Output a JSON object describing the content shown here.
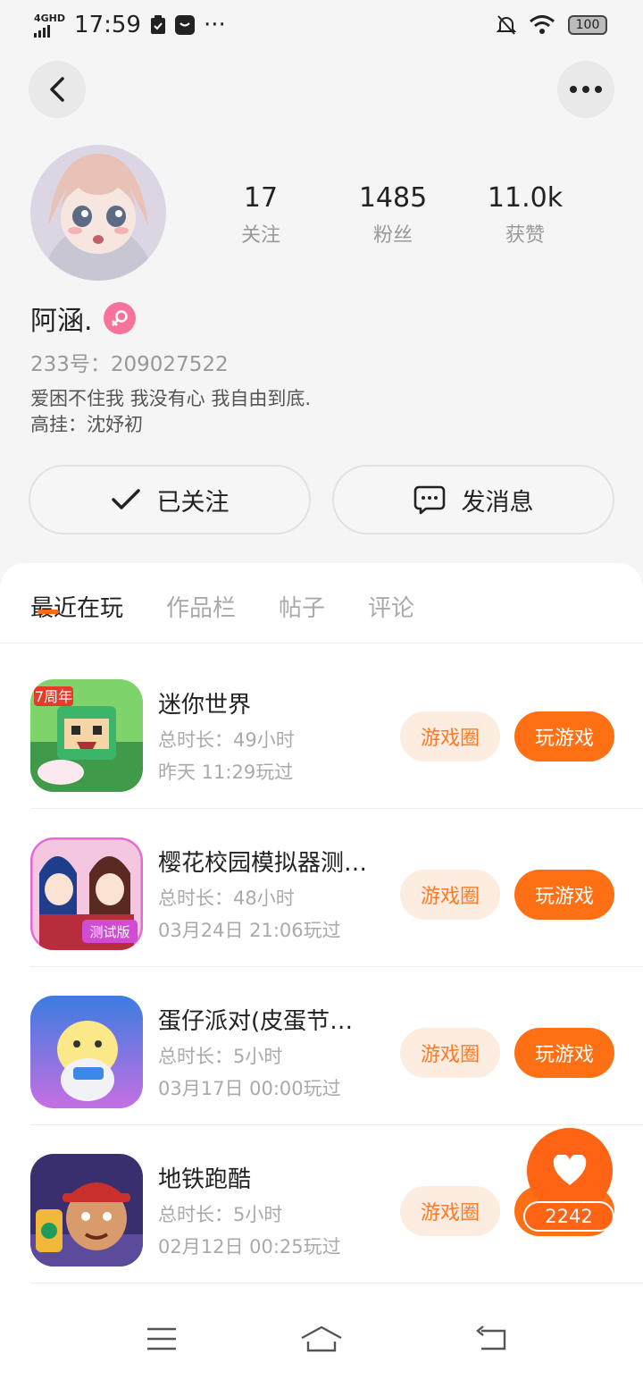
{
  "status_bar": {
    "network": "4GHD",
    "time": "17:59",
    "more": "···",
    "battery": "100"
  },
  "header": {
    "back_icon": "back-arrow-icon",
    "more_icon": "more-dots-icon",
    "more_label": "•••"
  },
  "profile": {
    "name": "阿涵.",
    "gender": "female",
    "uid": "233号：209027522",
    "bio_lines": [
      "爱困不住我 我没有心 我自由到底.",
      "高挂：沈妤初"
    ],
    "stats": [
      {
        "value": "17",
        "label": "关注"
      },
      {
        "value": "1485",
        "label": "粉丝"
      },
      {
        "value": "11.0k",
        "label": "获赞"
      }
    ]
  },
  "actions": {
    "follow_label": "已关注",
    "message_label": "发消息"
  },
  "tabs": [
    "最近在玩",
    "作品栏",
    "帖子",
    "评论"
  ],
  "games": [
    {
      "name": "迷你世界",
      "duration": "总时长：49小时",
      "last_played": "昨天 11:29玩过",
      "circle_label": "游戏圈",
      "play_label": "玩游戏"
    },
    {
      "name": "樱花校园模拟器测…",
      "duration": "总时长：48小时",
      "last_played": "03月24日 21:06玩过",
      "circle_label": "游戏圈",
      "play_label": "玩游戏"
    },
    {
      "name": "蛋仔派对(皮蛋节…",
      "duration": "总时长：5小时",
      "last_played": "03月17日 00:00玩过",
      "circle_label": "游戏圈",
      "play_label": "玩游戏"
    },
    {
      "name": "地铁跑酷",
      "duration": "总时长：5小时",
      "last_played": "02月12日 00:25玩过",
      "circle_label": "游戏圈",
      "play_label": "玩游戏"
    }
  ],
  "fab": {
    "count": "2242",
    "icon": "heart-icon"
  },
  "colors": {
    "accent": "#ff6a10",
    "accent_light": "#fdece0",
    "gender_badge": "#f7739b"
  }
}
